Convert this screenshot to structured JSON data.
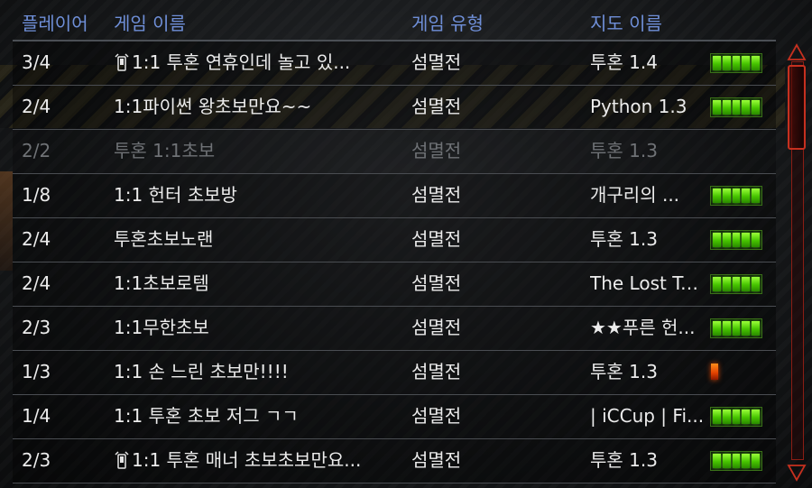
{
  "header": {
    "players_label": "플레이어",
    "name_label": "게임 이름",
    "type_label": "게임 유형",
    "map_label": "지도 이름"
  },
  "rows": [
    {
      "players": "3/4",
      "name": "1:1 투혼 연휴인데 놀고 있...",
      "type": "섬멸전",
      "map": "투혼 1.4",
      "mobile": true,
      "connection": "good",
      "disabled": false
    },
    {
      "players": "2/4",
      "name": "1:1파이썬 왕초보만요~~",
      "type": "섬멸전",
      "map": "Python 1.3",
      "mobile": false,
      "connection": "good",
      "disabled": false
    },
    {
      "players": "2/2",
      "name": "투혼 1:1초보",
      "type": "섬멸전",
      "map": "투혼 1.3",
      "mobile": false,
      "connection": "none",
      "disabled": true
    },
    {
      "players": "1/8",
      "name": "1:1 헌터 초보방",
      "type": "섬멸전",
      "map": "개구리의 ...",
      "mobile": false,
      "connection": "good",
      "disabled": false
    },
    {
      "players": "2/4",
      "name": "투혼초보노랜",
      "type": "섬멸전",
      "map": "투혼 1.3",
      "mobile": false,
      "connection": "good",
      "disabled": false
    },
    {
      "players": "2/4",
      "name": "1:1초보로템",
      "type": "섬멸전",
      "map": "The Lost Te...",
      "mobile": false,
      "connection": "good",
      "disabled": false
    },
    {
      "players": "2/3",
      "name": "1:1무한초보",
      "type": "섬멸전",
      "map": "★★푸른 헌...",
      "mobile": false,
      "connection": "good",
      "disabled": false
    },
    {
      "players": "1/3",
      "name": "1:1 손 느린 초보만!!!!",
      "type": "섬멸전",
      "map": "투혼 1.3",
      "mobile": false,
      "connection": "poor",
      "disabled": false
    },
    {
      "players": "1/4",
      "name": "1:1 투혼 초보 저그 ㄱㄱ",
      "type": "섬멸전",
      "map": "| iCCup | Fi...",
      "mobile": false,
      "connection": "good",
      "disabled": false
    },
    {
      "players": "2/3",
      "name": "1:1 투혼 매너 초보초보만요...",
      "type": "섬멸전",
      "map": "투혼 1.3",
      "mobile": true,
      "connection": "good",
      "disabled": false
    }
  ],
  "colors": {
    "header_text": "#6f8fd8",
    "row_text": "#ececec",
    "disabled_text": "#6f7276",
    "connection_good": "#46c400",
    "connection_poor": "#e04000",
    "scrollbar": "#c6301f"
  },
  "icons": {
    "mobile": "mobile-phone-icon",
    "scroll_up": "scroll-up-arrow-icon",
    "scroll_down": "scroll-down-arrow-icon"
  }
}
